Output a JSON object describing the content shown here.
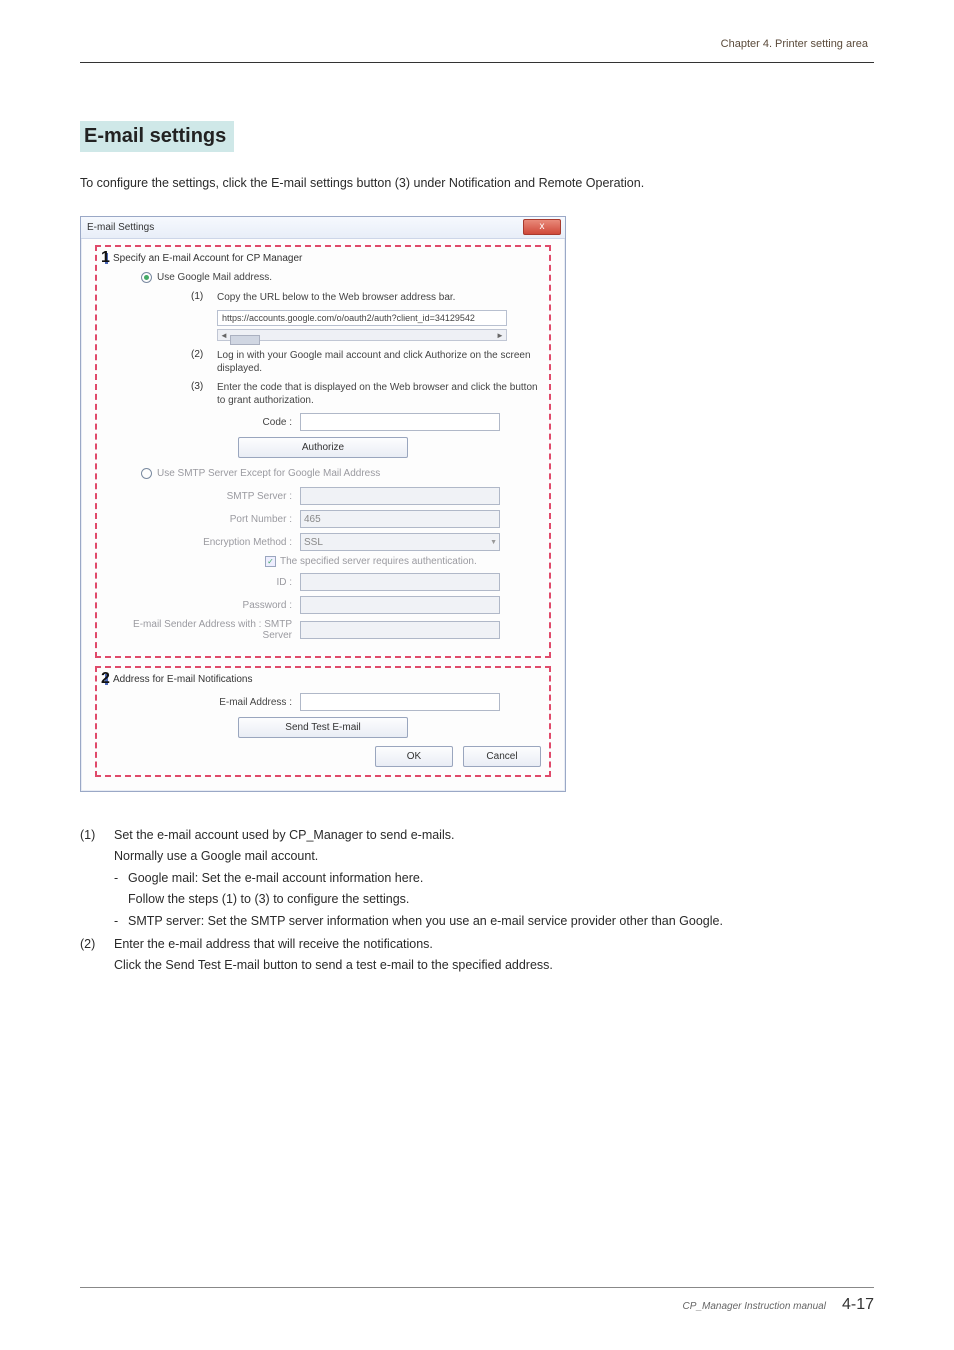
{
  "header": {
    "chapter": "Chapter 4.  Printer setting area"
  },
  "section": {
    "title": "E-mail settings",
    "intro": "To configure the settings, click the E-mail settings button (3) under Notification and Remote Operation."
  },
  "dialog": {
    "title": "E-mail Settings",
    "close": "x",
    "group1": {
      "header": "Specify an E-mail Account for CP Manager",
      "big_num": "1",
      "radio1_label": "Use Google Mail address.",
      "step1_num": "(1)",
      "step1_text": "Copy the URL below to the Web browser address bar.",
      "url": "https://accounts.google.com/o/oauth2/auth?client_id=34129542",
      "step2_num": "(2)",
      "step2_text": "Log in with your Google mail account and click Authorize on the screen displayed.",
      "step3_num": "(3)",
      "step3_text": "Enter the code that is displayed on the Web browser and click the button to grant authorization.",
      "code_label": "Code :",
      "authorize_btn": "Authorize",
      "radio2_label": "Use SMTP Server Except for Google Mail Address",
      "smtp_server_label": "SMTP Server :",
      "port_label": "Port Number :",
      "port_value": "465",
      "encryption_label": "Encryption Method :",
      "encryption_value": "SSL",
      "auth_checkbox": "The specified server requires authentication.",
      "id_label": "ID :",
      "password_label": "Password :",
      "sender_label": "E-mail Sender Address with : SMTP Server"
    },
    "group2": {
      "header": "Address for E-mail Notifications",
      "big_num": "2",
      "email_label": "E-mail Address :",
      "send_test_btn": "Send Test E-mail"
    },
    "ok_btn": "OK",
    "cancel_btn": "Cancel"
  },
  "desc": {
    "item1_num": "(1)",
    "item1_text": "Set the e-mail account used by CP_Manager to send e-mails.",
    "item1_sub1": "Normally use a Google mail account.",
    "item1_dash1": "Google mail: Set the e-mail account information here.",
    "item1_dash1_sub": "Follow the steps (1) to (3) to configure the settings.",
    "item1_dash2": "SMTP server: Set the SMTP server information when you use an e-mail service provider other than Google.",
    "item2_num": "(2)",
    "item2_text": "Enter the e-mail address that will receive the notifications.",
    "item2_sub1": "Click the Send Test E-mail button to send a test e-mail to the specified address."
  },
  "footer": {
    "label": "CP_Manager Instruction manual",
    "page": "4-17"
  }
}
